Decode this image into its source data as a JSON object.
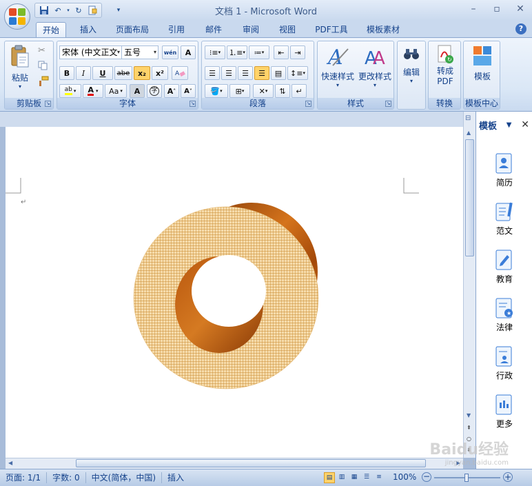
{
  "window": {
    "title": "文档 1 - Microsoft Word"
  },
  "tabs": [
    "开始",
    "插入",
    "页面布局",
    "引用",
    "邮件",
    "审阅",
    "视图",
    "PDF工具",
    "模板素材"
  ],
  "ribbon": {
    "clipboard": {
      "title": "剪贴板",
      "paste": "粘贴"
    },
    "font": {
      "title": "字体",
      "font_name": "宋体 (中文正文",
      "font_size": "五号",
      "bold": "B",
      "italic": "I",
      "underline": "U",
      "strike": "abe",
      "subscript": "x₂",
      "superscript": "x²",
      "grow": "A",
      "shrink": "A",
      "case": "Aa",
      "clear_format": "A",
      "phonetic": "wén",
      "border_char": "A",
      "char_shade": "A",
      "enclose": "字"
    },
    "paragraph": {
      "title": "段落"
    },
    "styles": {
      "title": "样式",
      "quick_styles": "快速样式",
      "change_styles": "更改样式"
    },
    "editing": {
      "label": "编辑"
    },
    "convert": {
      "title": "转换",
      "label_line1": "转成",
      "label_line2": "PDF"
    },
    "template": {
      "title": "模板中心",
      "label": "模板"
    }
  },
  "pane": {
    "title": "模板",
    "items": [
      "简历",
      "范文",
      "教育",
      "法律",
      "行政",
      "更多"
    ]
  },
  "status": {
    "page": "页面: 1/1",
    "words": "字数: 0",
    "language": "中文(简体，中国)",
    "mode": "插入",
    "zoom": "100%"
  },
  "watermark": {
    "brand": "Baidu经验",
    "url": "jingyan.baidu.com"
  },
  "colors": {
    "accent": "#15428b",
    "ring_face": "#f5d9a6",
    "ring_mesh": "#c98a2e",
    "ring_side": "#b8520f"
  }
}
